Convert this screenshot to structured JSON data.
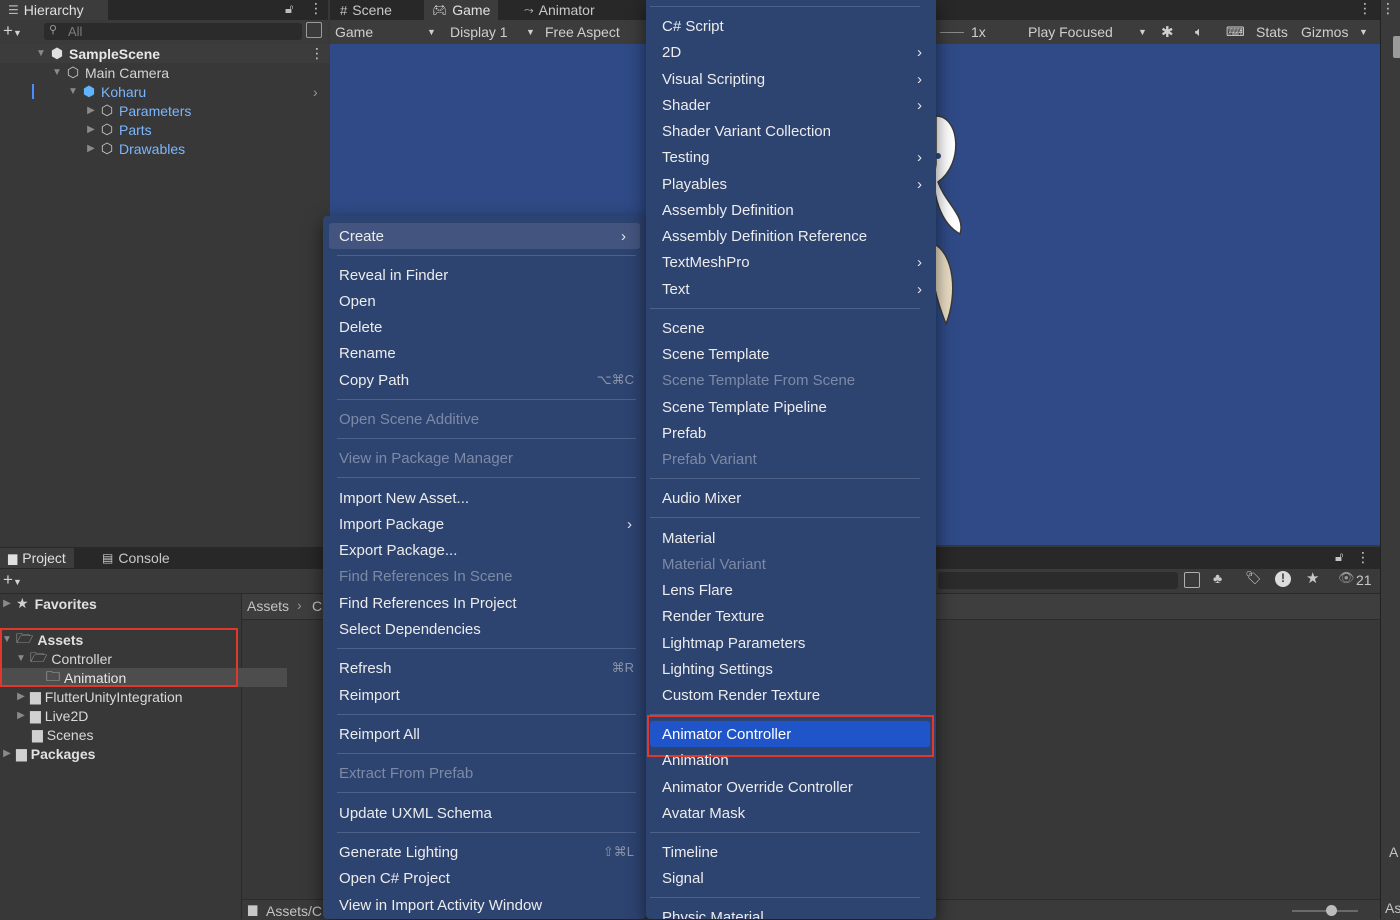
{
  "colors": {
    "game_bg": "#2f4a86",
    "menu_bg": "#2d4370",
    "menu_highlight": "#1f55c8",
    "annotation": "#e0382c",
    "hierarchy_link": "#7cb6ff"
  },
  "hierarchy": {
    "tab": "Hierarchy",
    "search_placeholder": "All",
    "items": [
      {
        "label": "SampleScene",
        "bold": true
      },
      {
        "label": "Main Camera"
      },
      {
        "label": "Koharu"
      },
      {
        "label": "Parameters"
      },
      {
        "label": "Parts"
      },
      {
        "label": "Drawables"
      }
    ]
  },
  "game_view": {
    "tabs": [
      "Scene",
      "Game",
      "Animator"
    ],
    "toolbar": {
      "mode": "Game",
      "display": "Display 1",
      "aspect": "Free Aspect",
      "scale": "1x",
      "play_mode": "Play Focused",
      "stats": "Stats",
      "gizmos": "Gizmos"
    }
  },
  "project": {
    "tabs": [
      "Project",
      "Console"
    ],
    "favorites": "Favorites",
    "tree": [
      "Assets",
      "Controller",
      "Animation",
      "FlutterUnityIntegration",
      "Live2D",
      "Scenes",
      "Packages"
    ],
    "breadcrumb": [
      "Assets",
      "C"
    ],
    "footer_path": "Assets/C",
    "visible_count": "21",
    "right_edge_labels": [
      "A",
      "As"
    ]
  },
  "context_menu": {
    "items": [
      {
        "label": "Create",
        "submenu": true,
        "highlight": true
      },
      {
        "label": "Reveal in Finder"
      },
      {
        "label": "Open"
      },
      {
        "label": "Delete"
      },
      {
        "label": "Rename"
      },
      {
        "label": "Copy Path",
        "shortcut": "⌥⌘C"
      },
      {
        "label": "Open Scene Additive",
        "disabled": true
      },
      {
        "label": "View in Package Manager",
        "disabled": true
      },
      {
        "label": "Import New Asset..."
      },
      {
        "label": "Import Package",
        "submenu": true
      },
      {
        "label": "Export Package..."
      },
      {
        "label": "Find References In Scene",
        "disabled": true
      },
      {
        "label": "Find References In Project"
      },
      {
        "label": "Select Dependencies"
      },
      {
        "label": "Refresh",
        "shortcut": "⌘R"
      },
      {
        "label": "Reimport"
      },
      {
        "label": "Reimport All"
      },
      {
        "label": "Extract From Prefab",
        "disabled": true
      },
      {
        "label": "Update UXML Schema"
      },
      {
        "label": "Generate Lighting",
        "shortcut": "⇧⌘L"
      },
      {
        "label": "Open C# Project"
      },
      {
        "label": "View in Import Activity Window"
      }
    ]
  },
  "create_submenu": {
    "items": [
      {
        "label": "C# Script"
      },
      {
        "label": "2D",
        "submenu": true
      },
      {
        "label": "Visual Scripting",
        "submenu": true
      },
      {
        "label": "Shader",
        "submenu": true
      },
      {
        "label": "Shader Variant Collection"
      },
      {
        "label": "Testing",
        "submenu": true
      },
      {
        "label": "Playables",
        "submenu": true
      },
      {
        "label": "Assembly Definition"
      },
      {
        "label": "Assembly Definition Reference"
      },
      {
        "label": "TextMeshPro",
        "submenu": true
      },
      {
        "label": "Text",
        "submenu": true
      },
      {
        "label": "Scene"
      },
      {
        "label": "Scene Template"
      },
      {
        "label": "Scene Template From Scene",
        "disabled": true
      },
      {
        "label": "Scene Template Pipeline"
      },
      {
        "label": "Prefab"
      },
      {
        "label": "Prefab Variant",
        "disabled": true
      },
      {
        "label": "Audio Mixer"
      },
      {
        "label": "Material"
      },
      {
        "label": "Material Variant",
        "disabled": true
      },
      {
        "label": "Lens Flare"
      },
      {
        "label": "Render Texture"
      },
      {
        "label": "Lightmap Parameters"
      },
      {
        "label": "Lighting Settings"
      },
      {
        "label": "Custom Render Texture"
      },
      {
        "label": "Animator Controller",
        "highlight": true
      },
      {
        "label": "Animation"
      },
      {
        "label": "Animator Override Controller"
      },
      {
        "label": "Avatar Mask"
      },
      {
        "label": "Timeline"
      },
      {
        "label": "Signal"
      },
      {
        "label": "Physic Material"
      }
    ]
  }
}
